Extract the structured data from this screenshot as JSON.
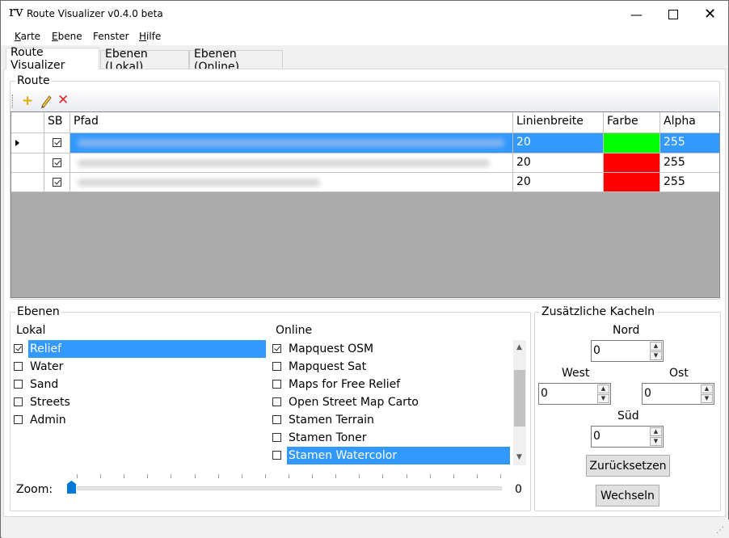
{
  "window": {
    "app_icon": "rv",
    "title": "Route Visualizer v0.4.0 beta",
    "minimize_icon": "minimize-icon",
    "maximize_icon": "maximize-icon",
    "close_icon": "close-icon"
  },
  "menu": {
    "items": [
      {
        "label_u": "K",
        "label_rest": "arte"
      },
      {
        "label_u": "E",
        "label_rest": "bene"
      },
      {
        "label_u": "",
        "label_rest": "Fenster"
      },
      {
        "label_u": "H",
        "label_rest": "ilfe"
      }
    ]
  },
  "tabs": [
    {
      "label": "Route Visualizer",
      "active": true
    },
    {
      "label": "Ebenen (Lokal)",
      "active": false
    },
    {
      "label": "Ebenen (Online)",
      "active": false
    }
  ],
  "route": {
    "group_label": "Route",
    "toolbar_icons": [
      "add-icon",
      "edit-icon",
      "delete-icon"
    ],
    "columns": [
      "",
      "SB",
      "Pfad",
      "Linienbreite",
      "Farbe",
      "Alpha"
    ],
    "rows": [
      {
        "selected": true,
        "sb": true,
        "pfad": "",
        "linienbreite": "20",
        "farbe": "#00ff00",
        "alpha": "255"
      },
      {
        "selected": false,
        "sb": true,
        "pfad": "",
        "linienbreite": "20",
        "farbe": "#ff0000",
        "alpha": "255"
      },
      {
        "selected": false,
        "sb": true,
        "pfad": "",
        "linienbreite": "20",
        "farbe": "#ff0000",
        "alpha": "255"
      }
    ]
  },
  "ebenen": {
    "group_label": "Ebenen",
    "lokal_label": "Lokal",
    "online_label": "Online",
    "lokal_items": [
      {
        "label": "Relief",
        "checked": true,
        "selected": true
      },
      {
        "label": "Water",
        "checked": false,
        "selected": false
      },
      {
        "label": "Sand",
        "checked": false,
        "selected": false
      },
      {
        "label": "Streets",
        "checked": false,
        "selected": false
      },
      {
        "label": "Admin",
        "checked": false,
        "selected": false
      }
    ],
    "online_items": [
      {
        "label": "Mapquest OSM",
        "checked": true,
        "selected": false
      },
      {
        "label": "Mapquest Sat",
        "checked": false,
        "selected": false
      },
      {
        "label": "Maps for Free Relief",
        "checked": false,
        "selected": false
      },
      {
        "label": "Open Street Map Carto",
        "checked": false,
        "selected": false
      },
      {
        "label": "Stamen Terrain",
        "checked": false,
        "selected": false
      },
      {
        "label": "Stamen Toner",
        "checked": false,
        "selected": false
      },
      {
        "label": "Stamen Watercolor",
        "checked": false,
        "selected": true
      }
    ],
    "zoom_label": "Zoom:",
    "zoom_value": "0",
    "zoom_level": 0
  },
  "kacheln": {
    "group_label": "Zusätzliche Kacheln",
    "nord_label": "Nord",
    "west_label": "West",
    "ost_label": "Ost",
    "sued_label": "Süd",
    "nord_value": "0",
    "west_value": "0",
    "ost_value": "0",
    "sued_value": "0",
    "reset_label": "Zurücksetzen",
    "switch_label": "Wechseln"
  },
  "colors": {
    "selection": "#3399ff",
    "grid_background": "#ababab"
  }
}
